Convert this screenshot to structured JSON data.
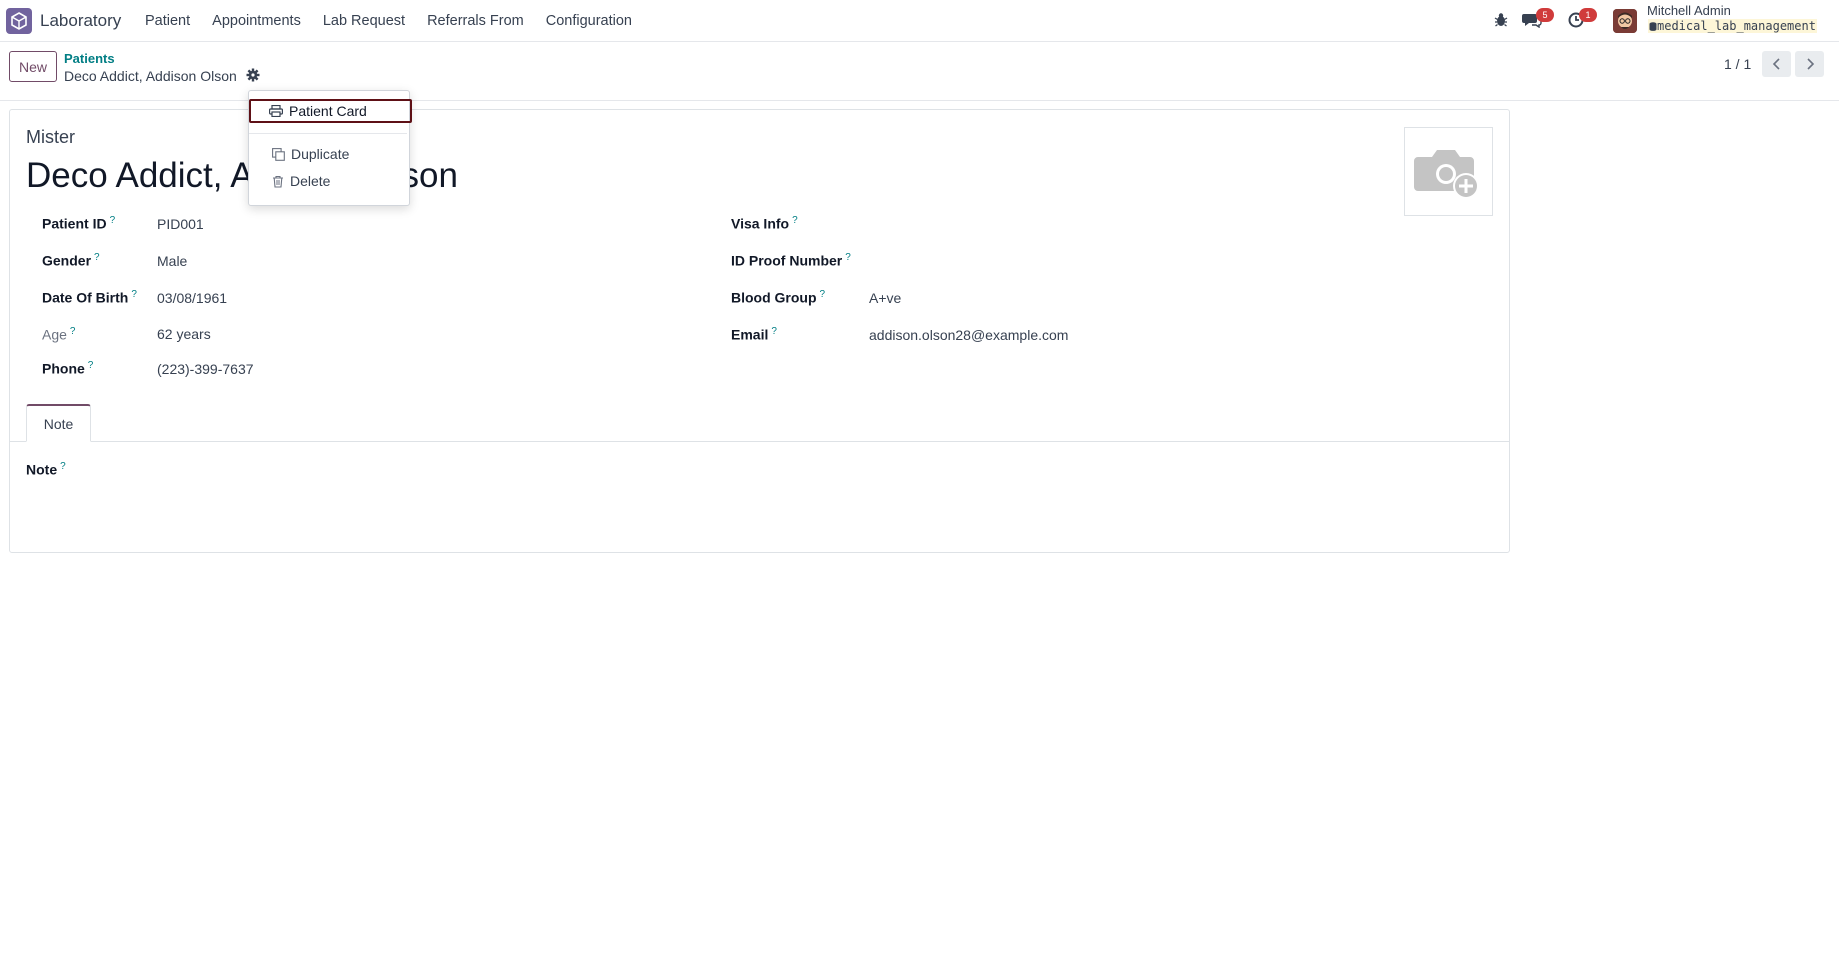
{
  "navbar": {
    "app_name": "Laboratory",
    "menu": [
      "Patient",
      "Appointments",
      "Lab Request",
      "Referrals From",
      "Configuration"
    ],
    "messages_badge": "5",
    "activities_badge": "1",
    "user_name": "Mitchell Admin",
    "database": "medical_lab_management"
  },
  "control_panel": {
    "new_label": "New",
    "breadcrumb_parent": "Patients",
    "breadcrumb_current": "Deco Addict, Addison Olson",
    "pager": "1 / 1"
  },
  "dropdown": {
    "items": [
      "Patient Card",
      "Duplicate",
      "Delete"
    ]
  },
  "form": {
    "title_prefix": "Mister",
    "title_name": "Deco Addict, Addison Olson",
    "left_fields": [
      {
        "label": "Patient ID",
        "value": "PID001"
      },
      {
        "label": "Gender",
        "value": "Male"
      },
      {
        "label": "Date Of Birth",
        "value": "03/08/1961"
      },
      {
        "label": "Age",
        "value": "62 years"
      },
      {
        "label": "Phone",
        "value": "(223)-399-7637"
      }
    ],
    "right_fields": [
      {
        "label": "Visa Info",
        "value": ""
      },
      {
        "label": "ID Proof Number",
        "value": ""
      },
      {
        "label": "Blood Group",
        "value": "A+ve"
      },
      {
        "label": "Email",
        "value": "addison.olson28@example.com"
      }
    ],
    "tab_label": "Note",
    "note_label": "Note",
    "help_mark": "?"
  },
  "colors": {
    "brand": "#714b67",
    "link": "#017e84",
    "badge": "#d03b3b",
    "active_outline": "#5e1016"
  }
}
